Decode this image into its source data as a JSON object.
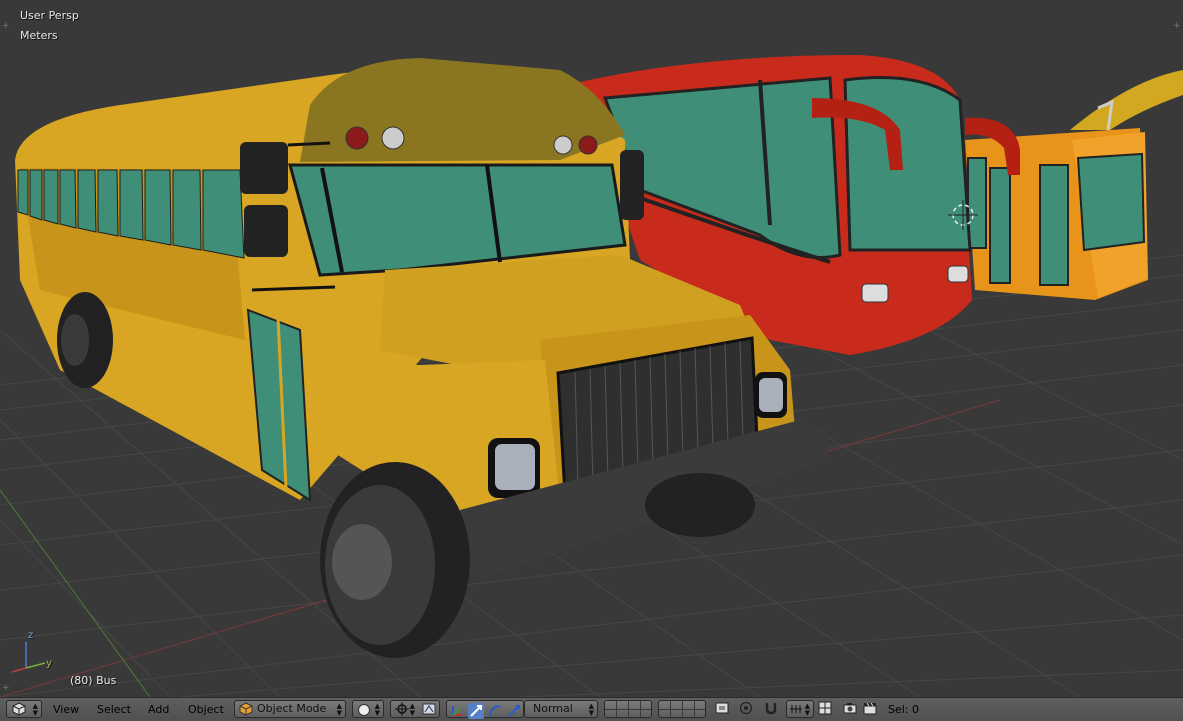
{
  "viewport": {
    "view_name": "User Persp",
    "units": "Meters",
    "active_object": "(80) Bus",
    "axis_labels": {
      "z": "z",
      "y": "y"
    }
  },
  "header": {
    "menus": {
      "view": "View",
      "select": "Select",
      "add": "Add",
      "object": "Object"
    },
    "mode": "Object Mode",
    "orientation": "Normal",
    "selection_count": "Sel: 0"
  },
  "colors": {
    "background": "#393939",
    "header": "#585858",
    "grid": "#4a4a4a",
    "school_bus": "#d8a623",
    "coach_bus": "#c82b1c",
    "orange_bus": "#e8931a",
    "windows": "#3f8f78",
    "x_axis": "#8a3a3a",
    "y_axis": "#5a9a3a"
  },
  "icons": {
    "editor_type": "cube-icon",
    "mode": "object-mode-cube-icon",
    "shading": "sphere-icon",
    "pivot": "pivot-icon",
    "manipulator": "transform-manipulator-icon",
    "snap": "magnet-icon",
    "render": "camera-icon"
  }
}
